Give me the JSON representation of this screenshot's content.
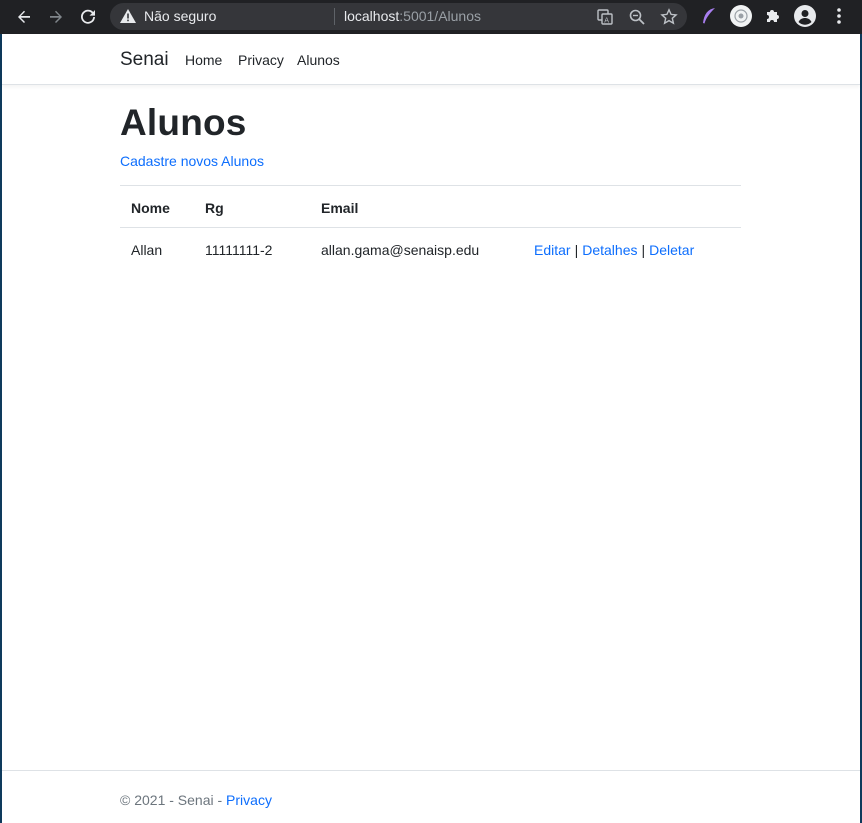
{
  "browser": {
    "security_label": "Não seguro",
    "url_host": "localhost",
    "url_rest": ":5001/Alunos"
  },
  "site": {
    "brand": "Senai",
    "nav": [
      "Home",
      "Privacy",
      "Alunos"
    ]
  },
  "main": {
    "title": "Alunos",
    "create_link": "Cadastre novos Alunos",
    "table": {
      "headers": [
        "Nome",
        "Rg",
        "Email"
      ],
      "rows": [
        {
          "nome": "Allan",
          "rg": "11111111-2",
          "email": "allan.gama@senaisp.edu",
          "actions": [
            "Editar",
            "Detalhes",
            "Deletar"
          ]
        }
      ]
    }
  },
  "footer": {
    "copyright": "© 2021 - Senai - ",
    "privacy_link": "Privacy"
  },
  "colors": {
    "link": "#0d6efd",
    "chrome_bg": "#202124",
    "omnibox_bg": "#35363a"
  }
}
